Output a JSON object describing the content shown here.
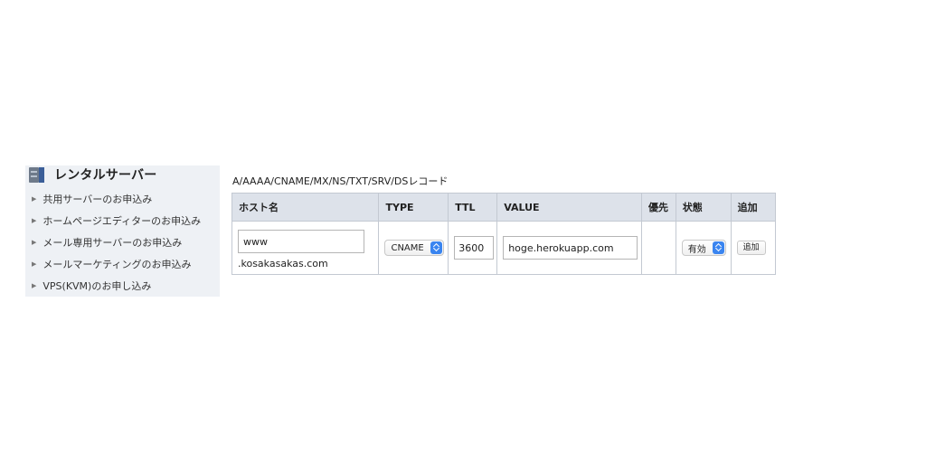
{
  "sidebar": {
    "title": "レンタルサーバー",
    "icon": "server-icon",
    "items": [
      {
        "label": "共用サーバーのお申込み"
      },
      {
        "label": "ホームページエディターのお申込み"
      },
      {
        "label": "メール専用サーバーのお申込み"
      },
      {
        "label": "メールマーケティングのお申込み"
      },
      {
        "label": "VPS(KVM)のお申し込み"
      }
    ]
  },
  "dns": {
    "section_title": "A/AAAA/CNAME/MX/NS/TXT/SRV/DSレコード",
    "headers": {
      "host": "ホスト名",
      "type": "TYPE",
      "ttl": "TTL",
      "value": "VALUE",
      "priority": "優先",
      "state": "状態",
      "add": "追加"
    },
    "row": {
      "host_value": "www",
      "host_suffix": ".kosakasakas.com",
      "type_selected": "CNAME",
      "ttl_value": "3600",
      "value_value": "hoge.herokuapp.com",
      "priority_value": "",
      "state_selected": "有効",
      "add_label": "追加"
    }
  },
  "colors": {
    "sidebar_bg": "#eef1f5",
    "header_bg": "#dde2ea",
    "select_accent": "#3a85f0"
  }
}
